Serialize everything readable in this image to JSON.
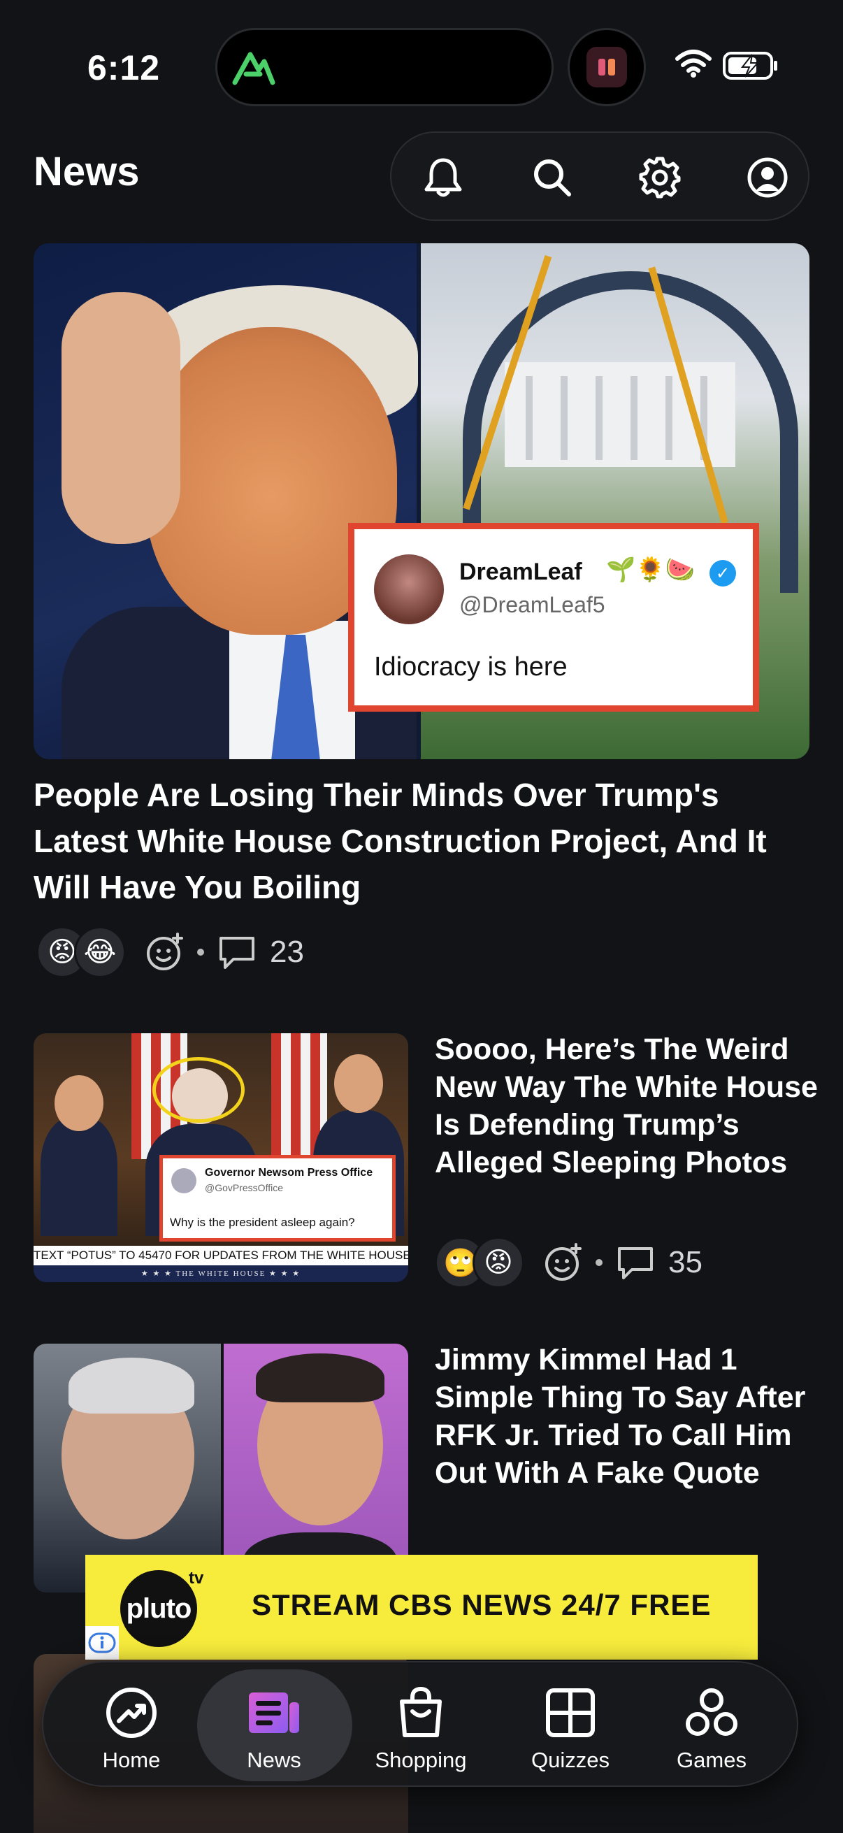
{
  "status_bar": {
    "time": "6:12"
  },
  "header": {
    "title": "News"
  },
  "hero": {
    "headline": "People Are Losing Their Minds Over Trump's Latest White House Construction Project, And It Will Have You Boiling",
    "tweet": {
      "name": "DreamLeaf",
      "emoji": "🌱🌻🍉",
      "handle": "@DreamLeaf5",
      "text": "Idiocracy is here"
    },
    "reactions": [
      "😡",
      "😂"
    ],
    "comment_count": "23"
  },
  "articles": [
    {
      "title": "Soooo, Here’s The Weird New Way The White House Is Defending Trump’s Alleged Sleeping Photos",
      "reactions": [
        "🙄",
        "😡"
      ],
      "comment_count": "35",
      "image": {
        "card_name": "Governor Newsom Press Office",
        "card_handle": "@GovPressOffice",
        "card_text": "Why is the president asleep again?",
        "ticker": "TEXT “POTUS” TO 45470 FOR UPDATES FROM THE WHITE HOUSE",
        "ticker_sub": "★ ★ ★  THE WHITE HOUSE  ★ ★ ★"
      }
    },
    {
      "title": "Jimmy Kimmel Had 1 Simple Thing To Say After RFK Jr. Tried To Call Him Out With A Fake Quote"
    }
  ],
  "ad": {
    "brand": "pluto",
    "brand_suffix": "tv",
    "text": "STREAM CBS NEWS 24/7 FREE"
  },
  "bottom_nav": {
    "items": [
      {
        "label": "Home",
        "icon": "trending-icon"
      },
      {
        "label": "News",
        "icon": "news-icon",
        "active": true
      },
      {
        "label": "Shopping",
        "icon": "shopping-bag-icon"
      },
      {
        "label": "Quizzes",
        "icon": "quizzes-grid-icon"
      },
      {
        "label": "Games",
        "icon": "games-icon"
      }
    ]
  },
  "colors": {
    "background": "#121316",
    "accent": "#c04fd9",
    "tweet_border": "#e0452f",
    "ad_yellow": "#f7ec3c"
  }
}
